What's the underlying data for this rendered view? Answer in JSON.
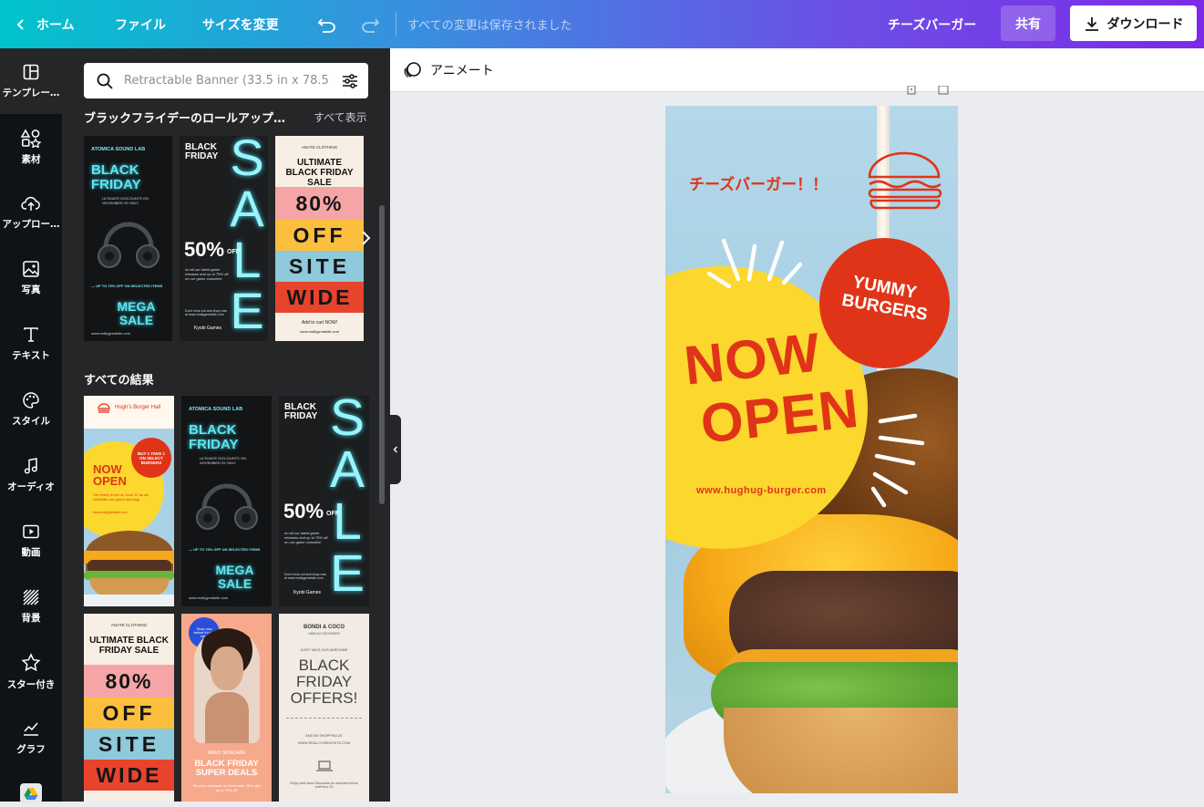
{
  "topbar": {
    "home": "ホーム",
    "file": "ファイル",
    "resize": "サイズを変更",
    "saved": "すべての変更は保存されました",
    "doc_title": "チーズバーガー",
    "share": "共有",
    "download": "ダウンロード"
  },
  "rail": [
    {
      "label": "テンプレー…",
      "icon": "template-icon"
    },
    {
      "label": "素材",
      "icon": "elements-icon"
    },
    {
      "label": "アップロー…",
      "icon": "upload-icon"
    },
    {
      "label": "写真",
      "icon": "photo-icon"
    },
    {
      "label": "テキスト",
      "icon": "text-icon"
    },
    {
      "label": "スタイル",
      "icon": "palette-icon"
    },
    {
      "label": "オーディオ",
      "icon": "music-icon"
    },
    {
      "label": "動画",
      "icon": "video-icon"
    },
    {
      "label": "背景",
      "icon": "background-icon"
    },
    {
      "label": "スター付き",
      "icon": "star-icon"
    },
    {
      "label": "グラフ",
      "icon": "chart-icon"
    }
  ],
  "panel": {
    "search_placeholder": "Retractable Banner (33.5 in x 78.5",
    "section1_title": "ブラックフライデーのロールアップ…",
    "see_all": "すべて表示",
    "section2_title": "すべての結果"
  },
  "templates": {
    "atomica": {
      "brand": "ATOMICA SOUND LAB",
      "head": "BLACK FRIDAY",
      "sub": "ULTIMATE DISCOUNTS ON NOVEMBER 25 ONLY",
      "offer": "— UP TO 75% OFF ON SELECTED ITEMS",
      "mega": "MEGA SALE",
      "url": "www.reallygreatsite.com"
    },
    "sale": {
      "head": "BLACK FRIDAY",
      "big": "SALE",
      "pct": "50%",
      "off": "OFF",
      "body": "on all our latest game releases and up to 75% off on our game consoles!",
      "cta": "Don't miss out and shop now at www.reallygreatsite.com",
      "brand": "Kyobi Games"
    },
    "anate": {
      "brand": "ANATE CLOTHING",
      "head": "ULTIMATE BLACK FRIDAY SALE",
      "rows": [
        "80%",
        "OFF",
        "SITE",
        "WIDE"
      ],
      "cta": "Add to cart NOW!",
      "url": "www.reallygreatsite.com"
    },
    "hugh": {
      "brand": "Hugh's Burger Hall",
      "badge": "BUY 1 TAKE 1 ON SELECT BURGERS",
      "head": "NOW OPEN",
      "body": "Get ready to eat on June 12 as we celebrate our grand opening!",
      "url": "www.reallygreatsite.com"
    },
    "fabio": {
      "badge": "Shop now before it's too late!",
      "brand": "FABIO SKINCARE",
      "head": "BLACK FRIDAY SUPER DEALS",
      "body": "Shop by and save on November 25 to get up to 70% off"
    },
    "bondi": {
      "brand": "BONDI & COCO",
      "sub": "HAIR ACCESSORIES",
      "tag": "DON'T MISS OUR AWESOME",
      "head": "BLACK FRIDAY OFFERS!",
      "find": "AND BE SHOPPING AT",
      "url": "WWW.REALLYGREATSITE.COM",
      "body": "Enjoy and save Discounts on selected items until Nov 29"
    }
  },
  "canvas": {
    "animate": "アニメート",
    "jp_title": "チーズバーガー！！",
    "now": "NOW",
    "open": "OPEN",
    "yummy": "YUMMY",
    "burgers": "BURGERS",
    "url": "www.hughug-burger.com",
    "colors": {
      "red": "#e03418",
      "yellow": "#fcd72d",
      "sky": "#a9d1e6"
    }
  }
}
